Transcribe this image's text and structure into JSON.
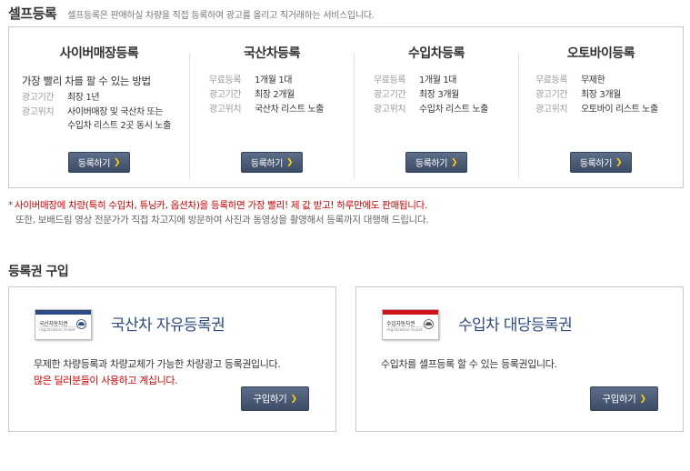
{
  "self_reg": {
    "title": "셀프등록",
    "description": "셀프등록은 판매하실 차량을 직접 등록하여 광고를 올리고 직거래하는 서비스입니다.",
    "columns": [
      {
        "title": "사이버매장등록",
        "lead": "가장 빨리 차를 팔 수 있는 방법",
        "rows": [
          {
            "key": "광고기간",
            "value": "최장 1년"
          },
          {
            "key": "광고위치",
            "value": "사이버매장 및 국산차 또는\n수입차 리스트 2곳 동시 노출"
          }
        ],
        "button": "등록하기"
      },
      {
        "title": "국산차등록",
        "rows": [
          {
            "key": "무료등록",
            "value": "1개월 1대"
          },
          {
            "key": "광고기간",
            "value": "최장 2개월"
          },
          {
            "key": "광고위치",
            "value": "국산차 리스트 노출"
          }
        ],
        "button": "등록하기"
      },
      {
        "title": "수입차등록",
        "rows": [
          {
            "key": "무료등록",
            "value": "1개월 1대"
          },
          {
            "key": "광고기간",
            "value": "최장 3개월"
          },
          {
            "key": "광고위치",
            "value": "수입차 리스트 노출"
          }
        ],
        "button": "등록하기"
      },
      {
        "title": "오토바이등록",
        "rows": [
          {
            "key": "무료등록",
            "value": "무제한"
          },
          {
            "key": "광고기간",
            "value": "최장 3개월"
          },
          {
            "key": "광고위치",
            "value": "오토바이 리스트 노출"
          }
        ],
        "button": "등록하기"
      }
    ]
  },
  "notes": {
    "star": "*",
    "line1": "사이버매장에 차량(특히 수입차, 튜닝카, 옵션차)을 등록하면 가장 빨리! 제 값 받고! 하루만에도 판매됩니다.",
    "line2": "또한, 보배드림 영상 전문가가 직접 차고지에 방문하여 사진과 동영상을 촬영해서 등록까지 대행해 드립니다."
  },
  "purchase": {
    "title": "등록권 구입",
    "items": [
      {
        "ticket_name": "국산자동차권",
        "ticket_sub": "registration ticket",
        "ticket_color": "#2d4a82",
        "name": "국산차 자유등록권",
        "desc": "무제한 차량등록과 차량교체가 가능한 차량광고 등록권입니다.",
        "note": "많은 딜러분들이 사용하고 계십니다.",
        "button": "구입하기"
      },
      {
        "ticket_name": "수입자동차권",
        "ticket_sub": "registration ticket",
        "ticket_color": "#d0121b",
        "name": "수입차 대당등록권",
        "desc": "수입차를 셀프등록 할 수 있는 등록권입니다.",
        "note": "",
        "button": "구입하기"
      }
    ]
  },
  "colors": {
    "button": "#3c4b65",
    "heading_blue": "#2d4a82",
    "highlight_red": "#cc0000",
    "arrow_yellow": "#ffd200"
  },
  "icons": [
    "chevron-right-icon",
    "car-icon"
  ]
}
